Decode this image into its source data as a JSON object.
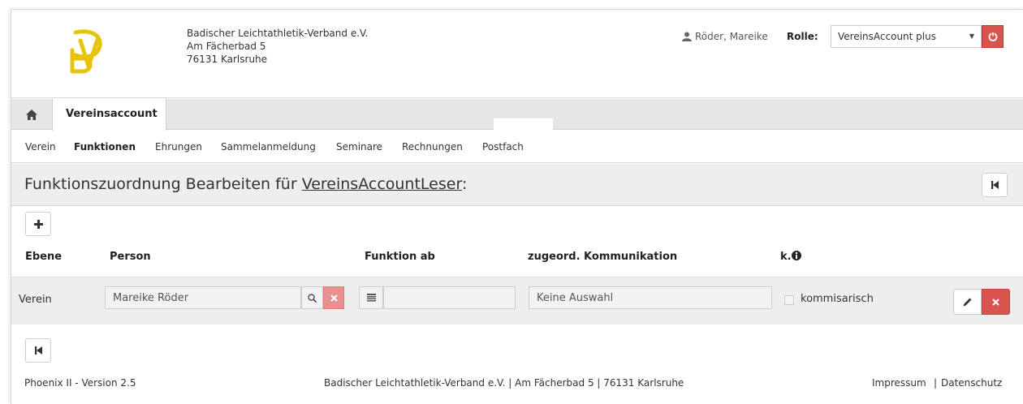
{
  "header": {
    "org_name": "Badischer Leichtathletik-Verband e.V.",
    "street": "Am Fächerbad 5",
    "city": "76131 Karlsruhe",
    "logo_icon": "blv-logo",
    "user_name": "Röder, Mareike",
    "role_label": "Rolle:",
    "role_value": "VereinsAccount plus"
  },
  "tabs": {
    "home_icon": "home-icon",
    "active_label": "Vereinsaccount"
  },
  "subnav": {
    "items": [
      "Verein",
      "Funktionen",
      "Ehrungen",
      "Sammelanmeldung",
      "Seminare",
      "Rechnungen",
      "Postfach"
    ],
    "active": "Funktionen"
  },
  "page": {
    "title_prefix": "Funktionszuordnung Bearbeiten für ",
    "title_link": "VereinsAccountLeser",
    "title_suffix": ":"
  },
  "table": {
    "headers": {
      "ebene": "Ebene",
      "person": "Person",
      "funktion_ab": "Funktion ab",
      "kommunikation": "zugeord. Kommunikation",
      "k": "k."
    },
    "rows": [
      {
        "ebene": "Verein",
        "person": "Mareike Röder",
        "funktion_ab": "",
        "kommunikation": "Keine Auswahl",
        "kommissarisch_label": "kommisarisch",
        "kommissarisch_checked": false
      }
    ]
  },
  "footer": {
    "version": "Phoenix II - Version 2.5",
    "address": "Badischer Leichtathletik-Verband e.V. | Am Fächerbad 5 | 76131 Karlsruhe",
    "impressum": "Impressum",
    "separator": "|",
    "datenschutz": "Datenschutz"
  },
  "colors": {
    "danger": "#d9534f",
    "logo_gold": "#e8c30c",
    "panel_gray": "#eeeeee"
  }
}
